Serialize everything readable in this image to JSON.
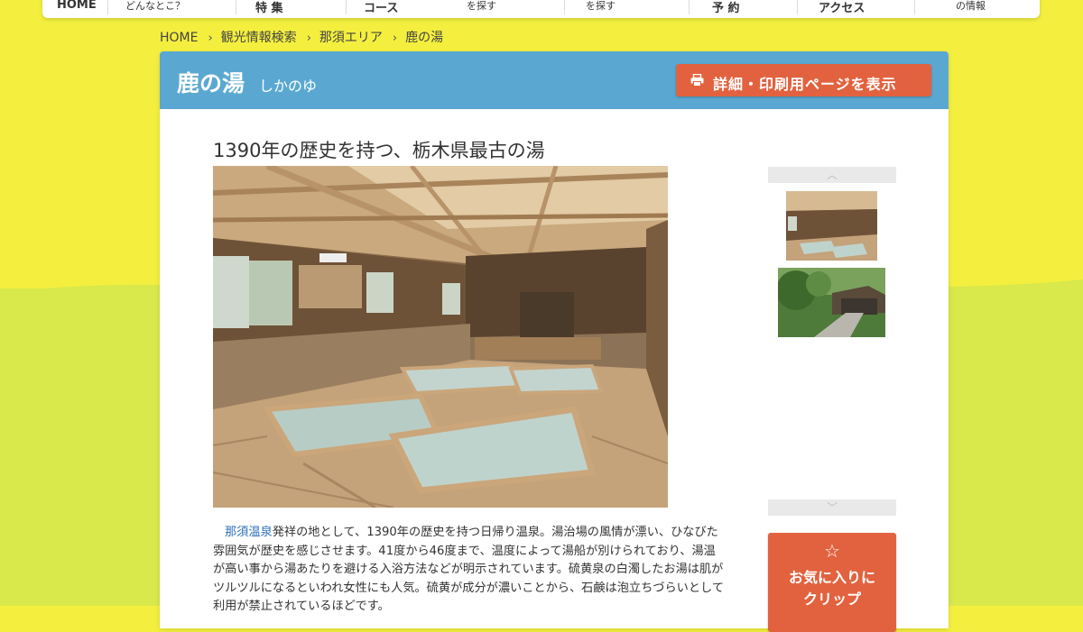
{
  "nav": {
    "items": [
      {
        "label": "HOME"
      },
      {
        "label": "どんなとこ？"
      },
      {
        "label": "特 集"
      },
      {
        "label": "コース"
      },
      {
        "label": "を探す"
      },
      {
        "label": "を探す"
      },
      {
        "label": "予 約"
      },
      {
        "label": "アクセス"
      },
      {
        "label": "の情報"
      }
    ]
  },
  "breadcrumb": [
    "HOME",
    "観光情報検索",
    "那須エリア",
    "鹿の湯"
  ],
  "card": {
    "title": "鹿の湯",
    "reading": "しかのゆ",
    "print_button": "詳細・印刷用ページを表示"
  },
  "headline": "1390年の歴史を持つ、栃木県最古の湯",
  "description": {
    "link": "那須温泉",
    "text": "発祥の地として、1390年の歴史を持つ日帰り温泉。湯治場の風情が漂い、ひなびた雰囲気が歴史を感じさせます。41度から46度まで、温度によって湯船が別けられており、湯温が高い事から湯あたりを避ける入浴方法などが明示されています。硫黄泉の白濁したお湯は肌がツルツルになるといわれ女性にも人気。硫黄が成分が濃いことから、石鹸は泡立ちづらいとして利用が禁止されているほどです。"
  },
  "clip_button": {
    "line1": "お気に入りに",
    "line2": "クリップ"
  },
  "colors": {
    "header_blue": "#5aa8d2",
    "button_orange": "#e2623f",
    "bg_yellow": "#f4ef3e",
    "bg_green": "#d9e84a",
    "link_blue": "#2b6fb8"
  }
}
